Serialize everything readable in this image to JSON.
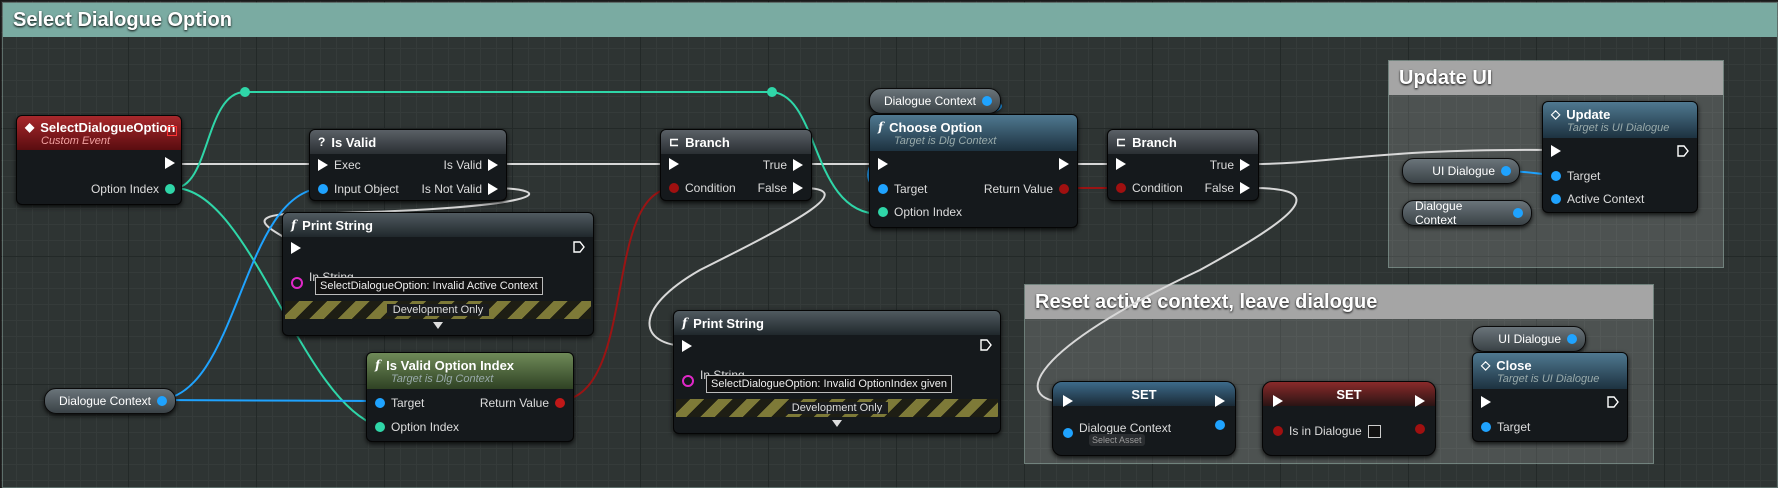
{
  "comments": {
    "main": "Select Dialogue Option",
    "update": "Update UI",
    "reset": "Reset active context, leave dialogue"
  },
  "nodes": {
    "event": {
      "title": "SelectDialogueOption",
      "subtitle": "Custom Event",
      "pin_option_index": "Option Index"
    },
    "is_valid": {
      "title": "Is Valid",
      "pin_exec": "Exec",
      "pin_input": "Input Object",
      "pin_valid": "Is Valid",
      "pin_not_valid": "Is Not Valid"
    },
    "print1": {
      "title": "Print String",
      "pin_in_string": "In String",
      "value": "SelectDialogueOption: Invalid Active Context",
      "dev": "Development Only"
    },
    "is_valid_option": {
      "title": "Is Valid Option Index",
      "subtitle": "Target is Dlg Context",
      "pin_target": "Target",
      "pin_option_index": "Option Index",
      "pin_return": "Return Value"
    },
    "branch1": {
      "title": "Branch",
      "pin_condition": "Condition",
      "pin_true": "True",
      "pin_false": "False"
    },
    "print2": {
      "title": "Print String",
      "pin_in_string": "In String",
      "value": "SelectDialogueOption: Invalid OptionIndex given",
      "dev": "Development Only"
    },
    "choose": {
      "title": "Choose Option",
      "subtitle": "Target is Dlg Context",
      "pin_target": "Target",
      "pin_option_index": "Option Index",
      "pin_return": "Return Value"
    },
    "branch2": {
      "title": "Branch",
      "pin_condition": "Condition",
      "pin_true": "True",
      "pin_false": "False"
    },
    "update": {
      "title": "Update",
      "subtitle": "Target is UI Dialogue",
      "pin_target": "Target",
      "pin_active_context": "Active Context"
    },
    "set1": {
      "title": "SET",
      "pin_dialogue_context": "Dialogue Context",
      "asset": "Select Asset"
    },
    "set2": {
      "title": "SET",
      "pin_is_in_dialogue": "Is in Dialogue"
    },
    "close": {
      "title": "Close",
      "subtitle": "Target is UI Dialogue",
      "pin_target": "Target"
    }
  },
  "vars": {
    "dialogue_context_left": "Dialogue Context",
    "dialogue_context_top": "Dialogue Context",
    "ui_dialogue_update": "UI Dialogue",
    "dialogue_context_update": "Dialogue Context",
    "ui_dialogue_close": "UI Dialogue"
  },
  "colors": {
    "exec_wire": "#ffffff",
    "int_wire": "#2fd6a8",
    "object_wire": "#1fa3ff",
    "bool_wire": "#a01010",
    "string_pin": "#e028c8"
  }
}
